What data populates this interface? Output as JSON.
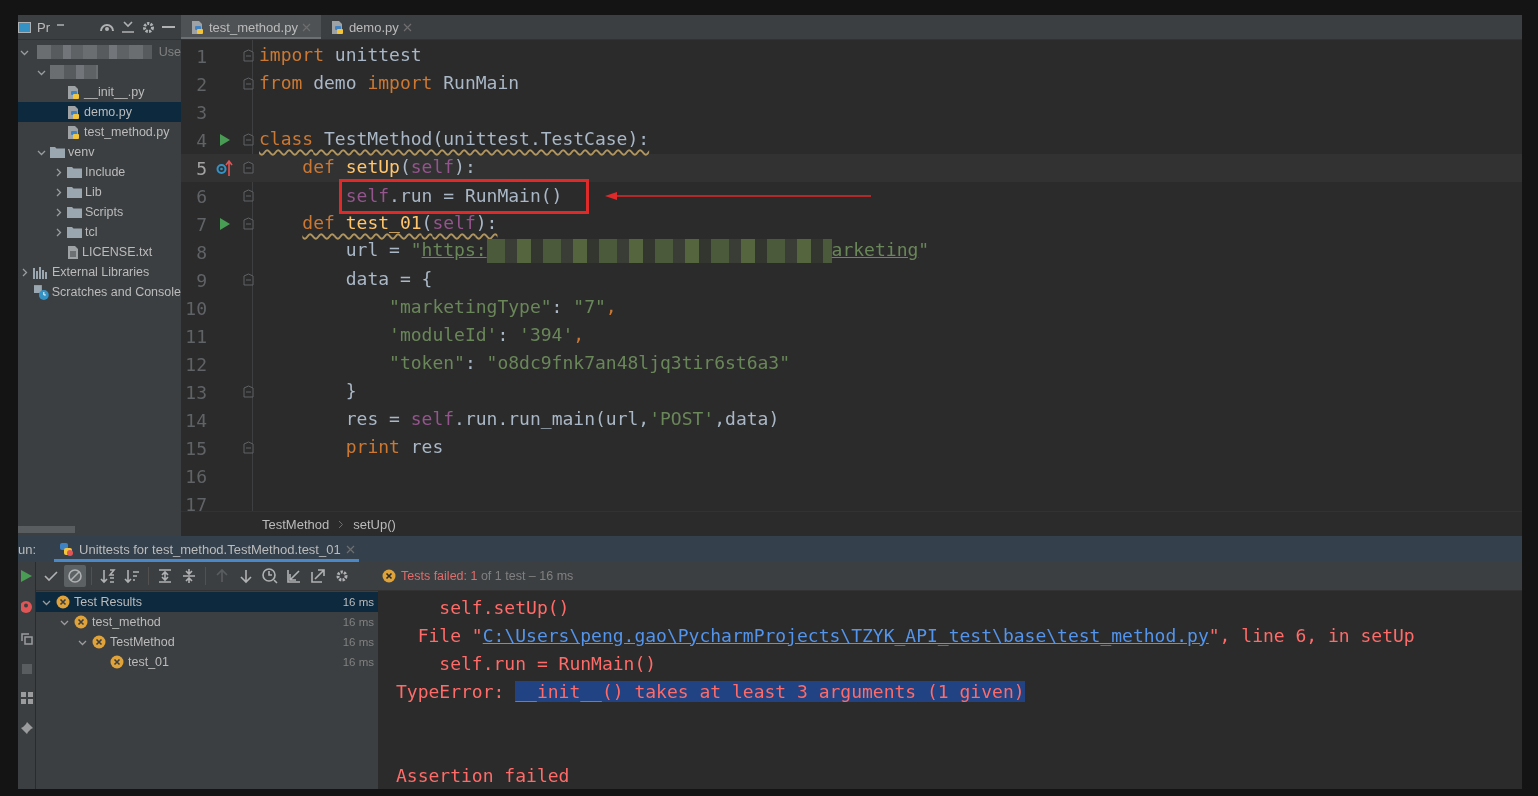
{
  "project_panel": {
    "title": "Pr",
    "tree": [
      {
        "kind": "redacted",
        "hint": "Use",
        "expanded": true,
        "selected": false,
        "children": [
          {
            "kind": "redacted",
            "expanded": true,
            "selected": false,
            "children": [
              {
                "kind": "python",
                "label": "__init__.py",
                "selected": false
              },
              {
                "kind": "python",
                "label": "demo.py",
                "selected": true
              },
              {
                "kind": "python",
                "label": "test_method.py",
                "selected": false
              }
            ]
          },
          {
            "kind": "folder",
            "label": "venv",
            "expanded": true,
            "selected": false,
            "children": [
              {
                "kind": "folder",
                "label": "Include",
                "expanded": false,
                "selected": false
              },
              {
                "kind": "folder",
                "label": "Lib",
                "expanded": false,
                "selected": false
              },
              {
                "kind": "folder",
                "label": "Scripts",
                "expanded": false,
                "selected": false
              },
              {
                "kind": "folder",
                "label": "tcl",
                "expanded": false,
                "selected": false
              },
              {
                "kind": "text",
                "label": "LICENSE.txt",
                "selected": false
              }
            ]
          }
        ]
      },
      {
        "kind": "library",
        "label": "External Libraries",
        "expanded": false,
        "selected": false
      },
      {
        "kind": "scratches",
        "label": "Scratches and Console",
        "selected": false
      }
    ]
  },
  "editor": {
    "tabs": [
      {
        "label": "test_method.py",
        "selected": true
      },
      {
        "label": "demo.py",
        "selected": false
      }
    ],
    "lines": [
      {
        "number": "1",
        "runnable": false,
        "overrides": false,
        "fold": true,
        "current": false,
        "warning": false,
        "annotated": false,
        "tokens": [
          {
            "kind": "keyword",
            "text": "import"
          },
          {
            "kind": "plain",
            "text": " unittest"
          }
        ]
      },
      {
        "number": "2",
        "runnable": false,
        "overrides": false,
        "fold": true,
        "current": false,
        "warning": false,
        "annotated": false,
        "tokens": [
          {
            "kind": "keyword",
            "text": "from"
          },
          {
            "kind": "plain",
            "text": " demo "
          },
          {
            "kind": "keyword",
            "text": "import"
          },
          {
            "kind": "plain",
            "text": " RunMain"
          }
        ]
      },
      {
        "number": "3",
        "runnable": false,
        "overrides": false,
        "fold": false,
        "current": false
      },
      {
        "number": "4",
        "runnable": true,
        "overrides": false,
        "fold": true,
        "current": false,
        "warning": true,
        "annotated": false,
        "tokens": [
          {
            "kind": "keyword",
            "text": "class"
          },
          {
            "kind": "plain",
            "text": " TestMethod(unittest.TestCase):"
          }
        ]
      },
      {
        "number": "5",
        "runnable": false,
        "overrides": true,
        "fold": true,
        "current": true,
        "warning": false,
        "annotated": false,
        "tokens": [
          {
            "kind": "keyword",
            "text": "    def"
          },
          {
            "kind": "func",
            "text": " setUp"
          },
          {
            "kind": "plain",
            "text": "("
          },
          {
            "kind": "self",
            "text": "self"
          },
          {
            "kind": "plain",
            "text": "):"
          }
        ]
      },
      {
        "number": "6",
        "runnable": false,
        "overrides": false,
        "fold": true,
        "current": false,
        "warning": false,
        "annotated": true,
        "tokens": [
          {
            "kind": "self",
            "text": "        self"
          },
          {
            "kind": "plain",
            "text": ".run = RunMain()"
          }
        ]
      },
      {
        "number": "7",
        "runnable": true,
        "overrides": false,
        "fold": true,
        "current": false,
        "warning": true,
        "annotated": false,
        "tokens": [
          {
            "kind": "keyword",
            "text": "    def"
          },
          {
            "kind": "func",
            "text": " test_01"
          },
          {
            "kind": "plain",
            "text": "("
          },
          {
            "kind": "self",
            "text": "self"
          },
          {
            "kind": "plain",
            "text": "):"
          }
        ]
      },
      {
        "number": "8",
        "runnable": false,
        "overrides": false,
        "fold": false,
        "current": false,
        "warning": false,
        "annotated": false,
        "tokens": [
          {
            "kind": "plain",
            "text": "        url = "
          },
          {
            "kind": "string",
            "text": "\""
          },
          {
            "kind": "url",
            "text": "https:"
          },
          {
            "kind": "redacted"
          },
          {
            "kind": "url",
            "text": "arketing"
          },
          {
            "kind": "string",
            "text": "\""
          }
        ]
      },
      {
        "number": "9",
        "runnable": false,
        "overrides": false,
        "fold": true,
        "current": false,
        "warning": false,
        "annotated": false,
        "tokens": [
          {
            "kind": "plain",
            "text": "        data = {"
          }
        ]
      },
      {
        "number": "10",
        "runnable": false,
        "overrides": false,
        "fold": false,
        "current": false,
        "warning": false,
        "annotated": false,
        "tokens": [
          {
            "kind": "string",
            "text": "            \"marketingType\""
          },
          {
            "kind": "plain",
            "text": ": "
          },
          {
            "kind": "string",
            "text": "\"7\""
          },
          {
            "kind": "keyword",
            "text": ","
          }
        ]
      },
      {
        "number": "11",
        "runnable": false,
        "overrides": false,
        "fold": false,
        "current": false,
        "warning": false,
        "annotated": false,
        "tokens": [
          {
            "kind": "string",
            "text": "            'moduleId'"
          },
          {
            "kind": "plain",
            "text": ": "
          },
          {
            "kind": "string",
            "text": "'394'"
          },
          {
            "kind": "keyword",
            "text": ","
          }
        ]
      },
      {
        "number": "12",
        "runnable": false,
        "overrides": false,
        "fold": false,
        "current": false,
        "warning": false,
        "annotated": false,
        "tokens": [
          {
            "kind": "string",
            "text": "            \"token\""
          },
          {
            "kind": "plain",
            "text": ": "
          },
          {
            "kind": "string",
            "text": "\"o8dc9fnk7an48ljq3tir6st6a3\""
          }
        ]
      },
      {
        "number": "13",
        "runnable": false,
        "overrides": false,
        "fold": true,
        "current": false,
        "warning": false,
        "annotated": false,
        "tokens": [
          {
            "kind": "plain",
            "text": "        }"
          }
        ]
      },
      {
        "number": "14",
        "runnable": false,
        "overrides": false,
        "fold": false,
        "current": false,
        "warning": false,
        "annotated": false,
        "tokens": [
          {
            "kind": "plain",
            "text": "        res = "
          },
          {
            "kind": "self",
            "text": "self"
          },
          {
            "kind": "plain",
            "text": ".run.run_main(url,"
          },
          {
            "kind": "string",
            "text": "'POST'"
          },
          {
            "kind": "plain",
            "text": ",data)"
          }
        ]
      },
      {
        "number": "15",
        "runnable": false,
        "overrides": false,
        "fold": true,
        "current": false,
        "warning": false,
        "annotated": false,
        "tokens": [
          {
            "kind": "keyword",
            "text": "        print"
          },
          {
            "kind": "plain",
            "text": " res"
          }
        ]
      },
      {
        "number": "16",
        "runnable": false,
        "overrides": false,
        "fold": false,
        "current": false
      },
      {
        "number": "17",
        "runnable": false,
        "overrides": false,
        "fold": false,
        "current": false
      }
    ],
    "breadcrumb": [
      "TestMethod",
      "setUp()"
    ]
  },
  "run_panel": {
    "label": "un:",
    "tabs": [
      {
        "label": "Unittests for test_method.TestMethod.test_01",
        "selected": true
      }
    ],
    "toolbar": [
      [
        {
          "kind": "passed",
          "on": false,
          "disabled": false
        },
        {
          "kind": "ignored",
          "on": true,
          "disabled": false
        }
      ],
      [
        {
          "kind": "sort-alpha",
          "on": false,
          "disabled": false
        },
        {
          "kind": "sort-duration",
          "on": false,
          "disabled": false
        }
      ],
      [
        {
          "kind": "expand",
          "on": false,
          "disabled": false
        },
        {
          "kind": "collapse",
          "on": false,
          "disabled": false
        }
      ],
      [
        {
          "kind": "up",
          "on": false,
          "disabled": true
        },
        {
          "kind": "down",
          "on": false,
          "disabled": false
        },
        {
          "kind": "history",
          "on": false,
          "disabled": false
        },
        {
          "kind": "import",
          "on": false,
          "disabled": false
        },
        {
          "kind": "export",
          "on": false,
          "disabled": false
        },
        {
          "kind": "settings",
          "on": false,
          "disabled": false
        }
      ]
    ],
    "status": {
      "failed": "Tests failed: 1",
      "detail": "of 1 test – 16 ms"
    },
    "tests": [
      {
        "label": "Test Results",
        "time": "16 ms",
        "failed": true,
        "selected": true,
        "expanded": true,
        "children": [
          {
            "label": "test_method",
            "time": "16 ms",
            "failed": true,
            "selected": false,
            "expanded": true,
            "children": [
              {
                "label": "TestMethod",
                "time": "16 ms",
                "failed": true,
                "selected": false,
                "expanded": true,
                "children": [
                  {
                    "label": "test_01",
                    "time": "16 ms",
                    "failed": true,
                    "selected": false
                  }
                ]
              }
            ]
          }
        ]
      }
    ],
    "console": [
      {
        "kind": "text",
        "segments": [
          {
            "kind": "error",
            "text": "    self.setUp()"
          }
        ]
      },
      {
        "kind": "text",
        "segments": [
          {
            "kind": "error",
            "text": "  File \""
          },
          {
            "kind": "link",
            "text": "C:\\Users\\peng.gao\\PycharmProjects\\TZYK_API_test\\base\\test_method.py"
          },
          {
            "kind": "error",
            "text": "\", line 6, in setUp"
          }
        ]
      },
      {
        "kind": "text",
        "segments": [
          {
            "kind": "error",
            "text": "    self.run = RunMain()"
          }
        ]
      },
      {
        "kind": "text",
        "segments": [
          {
            "kind": "error",
            "text": "TypeError: "
          },
          {
            "kind": "selected",
            "text": "__init__() takes at least 3 arguments (1 given)"
          }
        ]
      },
      {
        "kind": "blank"
      },
      {
        "kind": "blank"
      },
      {
        "kind": "text",
        "segments": [
          {
            "kind": "error",
            "text": "Assertion failed"
          }
        ]
      }
    ]
  }
}
